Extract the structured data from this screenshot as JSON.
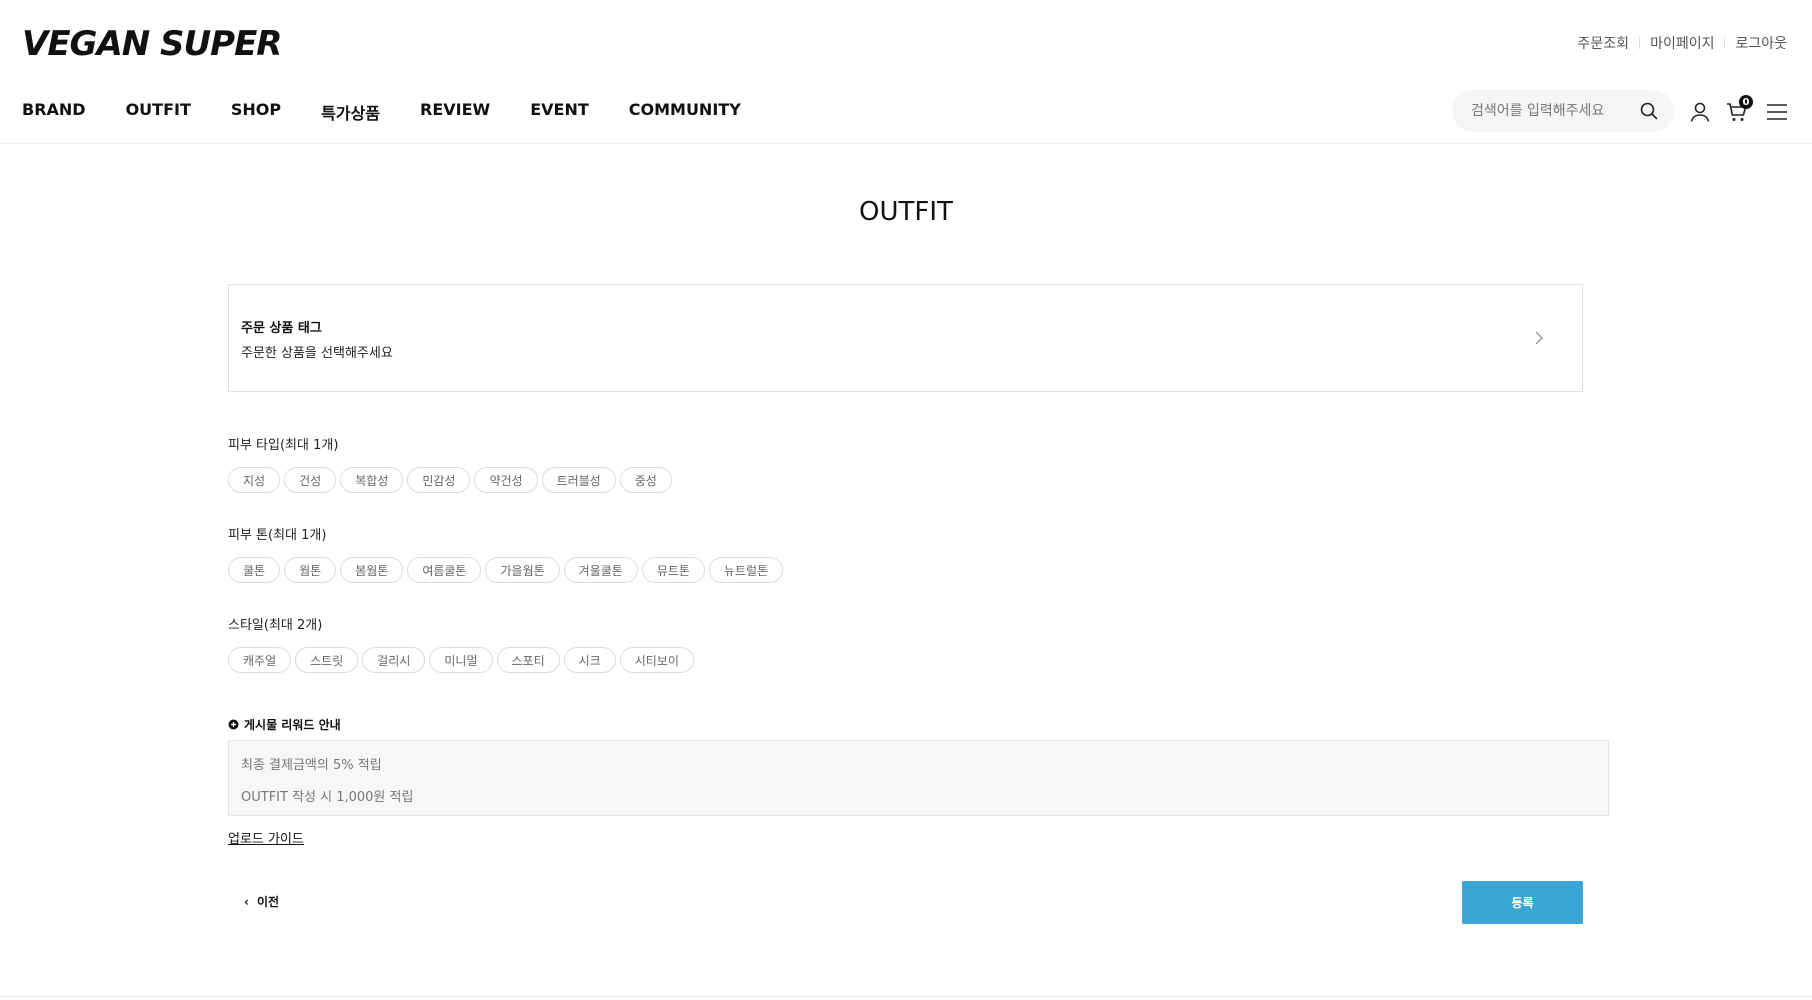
{
  "header": {
    "logo_text": "VEGAN SUPER",
    "util_links": [
      "주문조회",
      "마이페이지",
      "로그아웃"
    ],
    "nav": [
      "BRAND",
      "OUTFIT",
      "SHOP",
      "특가상품",
      "REVIEW",
      "EVENT",
      "COMMUNITY"
    ],
    "search": {
      "placeholder": "검색어를 입력해주세요",
      "icon": "search-icon"
    },
    "cart_count": "0",
    "icons": [
      "user-icon",
      "cart-icon",
      "menu-icon"
    ]
  },
  "page": {
    "title": "OUTFIT"
  },
  "order_tag": {
    "title": "주문 상품 태그",
    "subtitle": "주문한 상품을 선택해주세요"
  },
  "skin_type": {
    "label": "피부 타입(최대 1개)",
    "options": [
      "지성",
      "건성",
      "복합성",
      "민감성",
      "약건성",
      "트러블성",
      "중성"
    ]
  },
  "skin_tone": {
    "label": "피부 톤(최대 1개)",
    "options": [
      "쿨톤",
      "웜톤",
      "봄웜톤",
      "여름쿨톤",
      "가을웜톤",
      "겨울쿨톤",
      "뮤트톤",
      "뉴트럴톤"
    ]
  },
  "style": {
    "label": "스타일(최대 2개)",
    "options": [
      "캐주얼",
      "스트릿",
      "걸리시",
      "미니멀",
      "스포티",
      "시크",
      "시티보이"
    ]
  },
  "reward": {
    "title": "게시물 리워드 안내",
    "lines": [
      "최종 결제금액의 5% 적립",
      "OUTFIT 작성 시 1,000원 적립"
    ]
  },
  "upload_guide": "업로드 가이드",
  "actions": {
    "prev": "이전",
    "submit": "등록"
  },
  "colors": {
    "accent": "#3aa6d5",
    "text": "#111111",
    "chip_border": "#dcdcdc"
  }
}
